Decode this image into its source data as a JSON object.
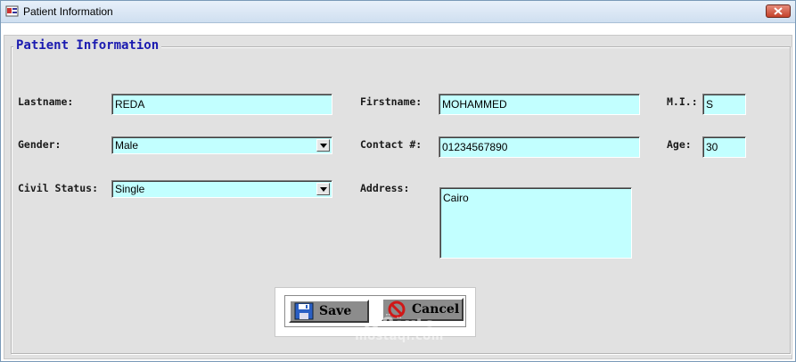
{
  "window": {
    "title": "Patient Information"
  },
  "group": {
    "legend": "Patient Information"
  },
  "labels": {
    "lastname": "Lastname:",
    "firstname": "Firstname:",
    "mi": "M.I.:",
    "gender": "Gender:",
    "contact": "Contact #:",
    "age": "Age:",
    "civil_status": "Civil Status:",
    "address": "Address:"
  },
  "values": {
    "lastname": "REDA",
    "firstname": "MOHAMMED",
    "mi": "S",
    "gender": "Male",
    "contact": "01234567890",
    "age": "30",
    "civil_status": "Single",
    "address": "Cairo"
  },
  "buttons": {
    "save": "Save",
    "cancel": "Cancel"
  },
  "watermark": {
    "arabic": "مستقل",
    "latin": "mostaql.com"
  },
  "colors": {
    "field_bg": "#c2ffff",
    "legend": "#1a1ab0",
    "form_bg": "#e1e1e1"
  }
}
